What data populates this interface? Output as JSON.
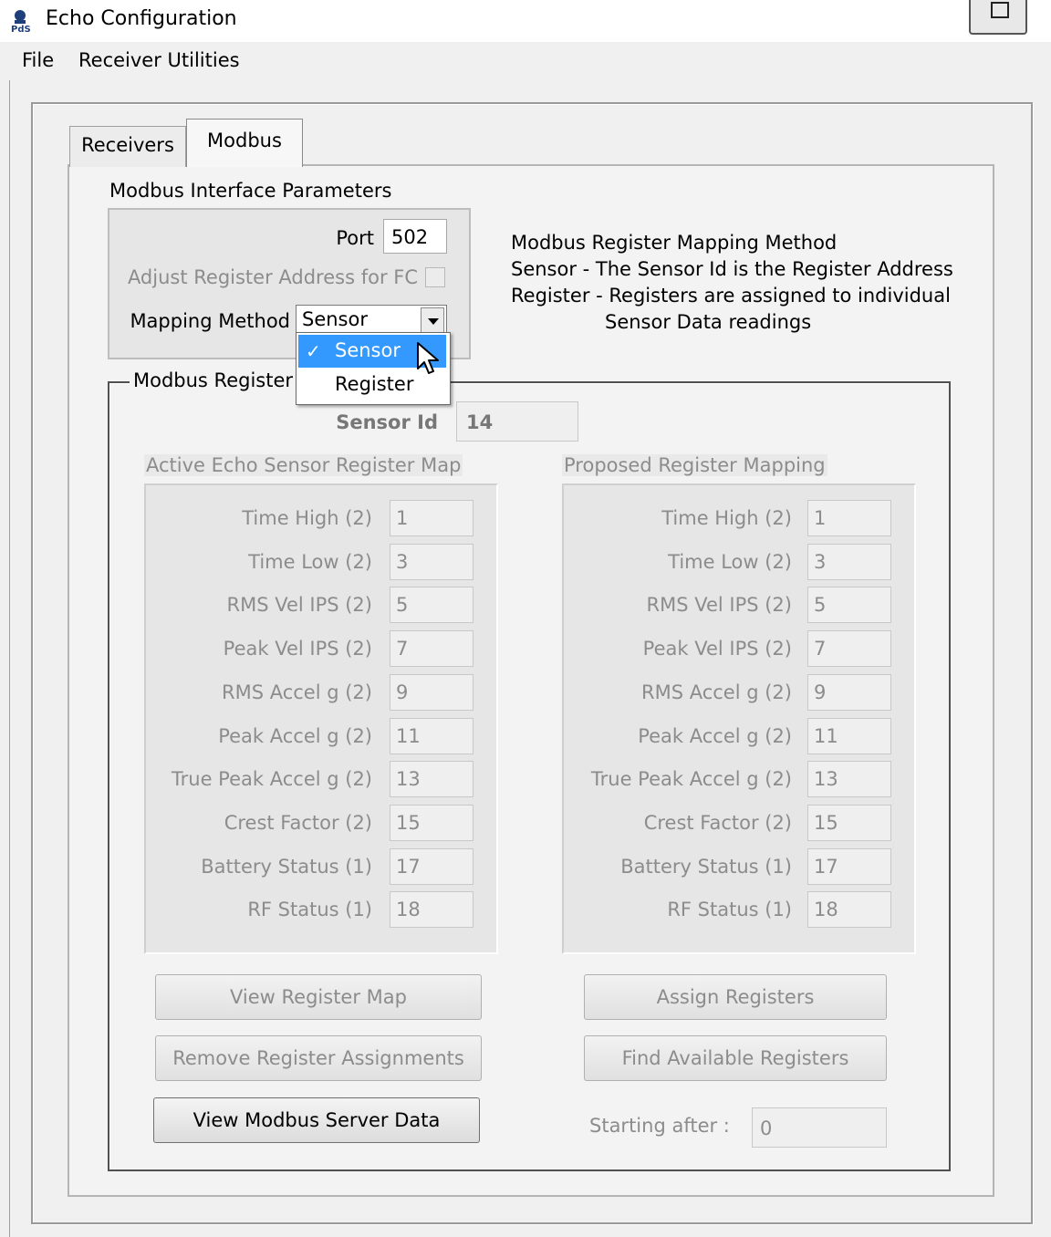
{
  "window": {
    "title": "Echo Configuration",
    "app_icon": "echo-app-icon",
    "help_button_icon": "window-button-icon"
  },
  "menu": [
    "File",
    "Receiver Utilities"
  ],
  "tabs": [
    {
      "label": "Receivers",
      "active": false
    },
    {
      "label": "Modbus",
      "active": true
    }
  ],
  "params": {
    "title": "Modbus Interface Parameters",
    "port_label": "Port",
    "port_value": "502",
    "adjust_label": "Adjust Register Address for FC",
    "adjust_checked": false,
    "mapping_label": "Mapping Method",
    "mapping_value": "Sensor",
    "mapping_options": [
      {
        "label": "Sensor",
        "selected": true,
        "check": "✓"
      },
      {
        "label": "Register",
        "selected": false
      }
    ]
  },
  "description": [
    "Modbus Register Mapping Method",
    "Sensor  -  The Sensor Id is the Register Address",
    "Register - Registers are assigned to individual",
    "Sensor Data readings"
  ],
  "register_group": {
    "title": "Modbus Register",
    "sensor_id_label": "Sensor Id",
    "sensor_id_value": "14",
    "active_title": "Active Echo Sensor Register Map",
    "proposed_title": "Proposed Register Mapping",
    "active_rows": [
      {
        "label": "Time High (2)",
        "value": "1"
      },
      {
        "label": "Time Low (2)",
        "value": "3"
      },
      {
        "label": "RMS Vel IPS (2)",
        "value": "5"
      },
      {
        "label": "Peak Vel IPS (2)",
        "value": "7"
      },
      {
        "label": "RMS Accel g (2)",
        "value": "9"
      },
      {
        "label": "Peak Accel  g (2)",
        "value": "11"
      },
      {
        "label": "True Peak Accel g (2)",
        "value": "13"
      },
      {
        "label": "Crest Factor (2)",
        "value": "15"
      },
      {
        "label": "Battery Status (1)",
        "value": "17"
      },
      {
        "label": "RF Status (1)",
        "value": "18"
      }
    ],
    "proposed_rows": [
      {
        "label": "Time High (2)",
        "value": "1"
      },
      {
        "label": "Time Low (2)",
        "value": "3"
      },
      {
        "label": "RMS Vel IPS (2)",
        "value": "5"
      },
      {
        "label": "Peak Vel IPS (2)",
        "value": "7"
      },
      {
        "label": "RMS Accel g (2)",
        "value": "9"
      },
      {
        "label": "Peak Accel  g (2)",
        "value": "11"
      },
      {
        "label": "True Peak Accel g (2)",
        "value": "13"
      },
      {
        "label": "Crest Factor (2)",
        "value": "15"
      },
      {
        "label": "Battery Status (1)",
        "value": "17"
      },
      {
        "label": "RF Status (1)",
        "value": "18"
      }
    ],
    "buttons": {
      "view_register_map": "View Register Map",
      "remove_assignments": "Remove Register Assignments",
      "view_server_data": "View Modbus Server Data",
      "assign_registers": "Assign Registers",
      "find_available": "Find Available Registers"
    },
    "starting_after_label": "Starting after :",
    "starting_after_value": "0"
  }
}
